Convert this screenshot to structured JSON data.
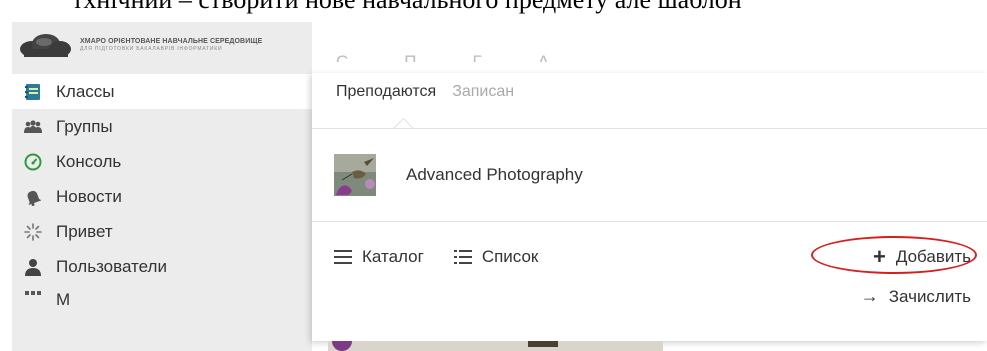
{
  "document": {
    "text": "тхнічнии – створити нове навчального предмету але шаблон"
  },
  "sidebar": {
    "logo": {
      "title": "ХМАРО ОРІЄНТОВАНЕ НАВЧАЛЬНЕ СЕРЕДОВИЩЕ",
      "subtitle": "ДЛЯ ПІДГОТОВКИ БАКАЛАВРІВ ІНФОРМАТИКИ"
    },
    "items": [
      {
        "label": "Классы",
        "icon": "notebook-icon"
      },
      {
        "label": "Группы",
        "icon": "group-icon"
      },
      {
        "label": "Консоль",
        "icon": "gauge-icon"
      },
      {
        "label": "Новости",
        "icon": "bell-icon"
      },
      {
        "label": "Привет",
        "icon": "sparkle-icon"
      },
      {
        "label": "Пользователи",
        "icon": "user-icon"
      },
      {
        "label": "М",
        "icon": "grid-icon"
      }
    ]
  },
  "ghost_tabs": [
    "С",
    "П",
    "Г",
    "А"
  ],
  "panel": {
    "tabs": [
      {
        "label": "Преподаются",
        "active": true
      },
      {
        "label": "Записан",
        "active": false
      }
    ],
    "class_item": {
      "name": "Advanced Photography"
    },
    "views": {
      "catalog": "Каталог",
      "list": "Список"
    },
    "add_label": "Добавить",
    "enroll_label": "Зачислить"
  },
  "colors": {
    "sidebar_bg": "#ececec",
    "highlight": "#d62020",
    "gauge": "#2e9a3e"
  }
}
